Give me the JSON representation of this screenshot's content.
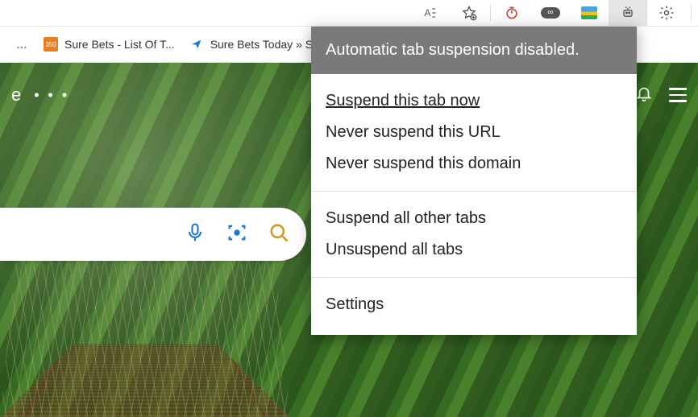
{
  "toolbar": {
    "readaloud_name": "read-aloud-icon",
    "favorite_name": "add-favorite-icon",
    "ext_timer_name": "timer-extension-icon",
    "ext_infinity_name": "infinity-extension-icon",
    "ext_map_name": "map-extension-icon",
    "ext_suspender_name": "tab-suspender-extension-icon",
    "settings_name": "browser-settings-icon"
  },
  "bookmarks": {
    "items": [
      {
        "label": "Sure Bets - List Of T...",
        "favicon_text": "350"
      },
      {
        "label": "Sure Bets Today » S..."
      }
    ]
  },
  "page_overlay": {
    "left_label": "e",
    "dots": "• • •"
  },
  "popup": {
    "header": "Automatic tab suspension disabled.",
    "group1": [
      "Suspend this tab now",
      "Never suspend this URL",
      "Never suspend this domain"
    ],
    "group2": [
      "Suspend all other tabs",
      "Unsuspend all tabs"
    ],
    "group3": [
      "Settings"
    ]
  }
}
